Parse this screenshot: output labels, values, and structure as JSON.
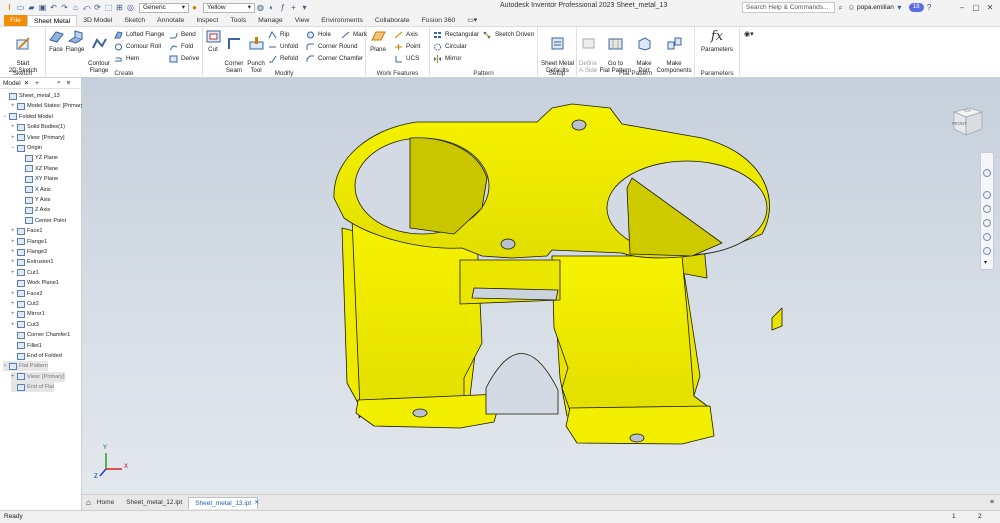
{
  "quick_access": {
    "appearance_value": "Generic",
    "color_value": "Yellow"
  },
  "app_title": "Autodesk Inventor Professional 2023   Sheet_metal_13",
  "title_right": {
    "search_placeholder": "Search Help & Commands...",
    "user": "popa.emilian",
    "notifications": "18"
  },
  "tabs": [
    "File",
    "Sheet Metal",
    "3D Model",
    "Sketch",
    "Annotate",
    "Inspect",
    "Tools",
    "Manage",
    "View",
    "Environments",
    "Collaborate",
    "Fusion 360"
  ],
  "ribbon": {
    "sketch": {
      "title": "Sketch",
      "start_sketch": "Start\n2D Sketch"
    },
    "create": {
      "title": "Create",
      "face": "Face",
      "flange": "Flange",
      "contour_flange": "Contour\nFlange",
      "lofted_flange": "Lofted Flange",
      "contour_roll": "Contour Roll",
      "hem": "Hem",
      "bend": "Bend",
      "fold": "Fold",
      "derive": "Derive"
    },
    "modify": {
      "title": "Modify",
      "cut": "Cut",
      "corner_seam": "Corner\nSeam",
      "punch_tool": "Punch\nTool",
      "rip": "Rip",
      "unfold": "Unfold",
      "refold": "Refold",
      "hole": "Hole",
      "corner_round": "Corner Round",
      "corner_chamfer": "Corner Chamfer",
      "mark": "Mark"
    },
    "work_features": {
      "title": "Work Features",
      "plane": "Plane",
      "axis": "Axis",
      "point": "Point",
      "ucs": "UCS"
    },
    "pattern": {
      "title": "Pattern",
      "rectangular": "Rectangular",
      "circular": "Circular",
      "mirror": "Mirror",
      "sketch_driven": "Sketch Driven"
    },
    "setup": {
      "title": "Setup",
      "sheet_metal_defaults": "Sheet Metal\nDefaults"
    },
    "flat_pattern": {
      "title": "Flat Pattern",
      "define_a_side": "Define\nA-Side",
      "go_to_flat_pattern": "Go to\nFlat Pattern",
      "make_part": "Make\nPart",
      "make_components": "Make\nComponents"
    },
    "parameters": {
      "title": "Parameters",
      "parameters": "Parameters"
    }
  },
  "browser": {
    "tab_label": "Model",
    "nodes": [
      {
        "label": "Sheet_metal_13",
        "level": 0,
        "expander": ""
      },
      {
        "label": "Model States: [Primary]",
        "level": 1,
        "expander": "+"
      },
      {
        "label": "Folded Model",
        "level": 0,
        "expander": "−"
      },
      {
        "label": "Solid Bodies(1)",
        "level": 1,
        "expander": "+"
      },
      {
        "label": "View: [Primary]",
        "level": 1,
        "expander": "+"
      },
      {
        "label": "Origin",
        "level": 1,
        "expander": "−"
      },
      {
        "label": "YZ Plane",
        "level": 2,
        "expander": ""
      },
      {
        "label": "XZ Plane",
        "level": 2,
        "expander": ""
      },
      {
        "label": "XY Plane",
        "level": 2,
        "expander": ""
      },
      {
        "label": "X Axis",
        "level": 2,
        "expander": ""
      },
      {
        "label": "Y Axis",
        "level": 2,
        "expander": ""
      },
      {
        "label": "Z Axis",
        "level": 2,
        "expander": ""
      },
      {
        "label": "Center Point",
        "level": 2,
        "expander": ""
      },
      {
        "label": "Face1",
        "level": 1,
        "expander": "+"
      },
      {
        "label": "Flange1",
        "level": 1,
        "expander": "+"
      },
      {
        "label": "Flange2",
        "level": 1,
        "expander": "+"
      },
      {
        "label": "Extrusion1",
        "level": 1,
        "expander": "+"
      },
      {
        "label": "Cut1",
        "level": 1,
        "expander": "+"
      },
      {
        "label": "Work Plane1",
        "level": 1,
        "expander": ""
      },
      {
        "label": "Face2",
        "level": 1,
        "expander": "+"
      },
      {
        "label": "Cut2",
        "level": 1,
        "expander": "+"
      },
      {
        "label": "Mirror1",
        "level": 1,
        "expander": "+"
      },
      {
        "label": "Cut3",
        "level": 1,
        "expander": "+"
      },
      {
        "label": "Corner Chamfer1",
        "level": 1,
        "expander": ""
      },
      {
        "label": "Fillet1",
        "level": 1,
        "expander": ""
      },
      {
        "label": "End of Folded",
        "level": 1,
        "expander": ""
      },
      {
        "label": "Flat Pattern",
        "level": 0,
        "expander": "−"
      },
      {
        "label": "View: [Primary]",
        "level": 1,
        "expander": "+"
      },
      {
        "label": "End of Flat",
        "level": 1,
        "expander": ""
      }
    ]
  },
  "viewcube": {
    "top": "TOP",
    "front": "FRONT"
  },
  "axis_labels": {
    "x": "X",
    "y": "Y",
    "z": "Z"
  },
  "doc_tabs": [
    {
      "label": "Home"
    },
    {
      "label": "Sheet_metal_12.ipt"
    },
    {
      "label": "Sheet_metal_13.ipt"
    }
  ],
  "status": {
    "text": "Ready",
    "n1": "1",
    "n2": "2"
  },
  "colors": {
    "part": "#f2f000",
    "accent": "#f28c00",
    "viewport_top": "#c6d0dc",
    "viewport_bottom": "#e3e8ed"
  }
}
